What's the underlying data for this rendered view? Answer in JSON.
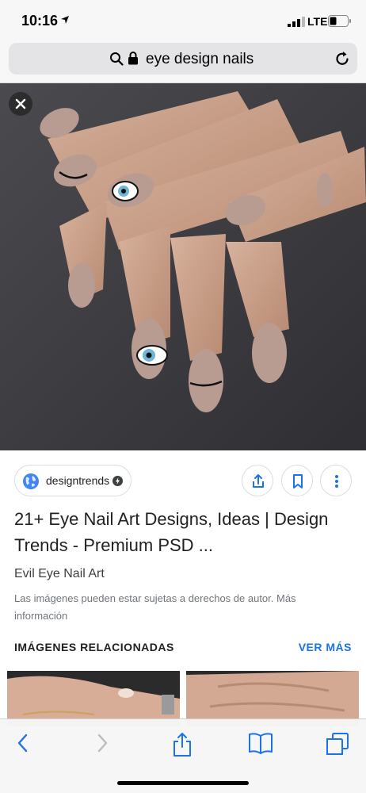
{
  "status_bar": {
    "time": "10:16",
    "network": "LTE"
  },
  "url_bar": {
    "query": "eye design nails"
  },
  "result": {
    "source": "designtrends",
    "title": "21+ Eye Nail Art Designs, Ideas | Design Trends - Premium PSD ...",
    "subtitle": "Evil Eye Nail Art",
    "copyright": "Las imágenes pueden estar sujetas a derechos de autor. Más información"
  },
  "related": {
    "header": "IMÁGENES RELACIONADAS",
    "see_more": "VER MÁS"
  },
  "icons": {
    "close": "close-icon",
    "share": "share-icon",
    "bookmark": "bookmark-icon",
    "more": "more-vert-icon",
    "back": "chevron-left-icon",
    "forward": "chevron-right-icon",
    "bookmarks": "book-icon",
    "tabs": "tabs-icon"
  },
  "colors": {
    "accent": "#1a73e8",
    "nail": "#b89b91",
    "background_photo": "#3f3f43"
  }
}
